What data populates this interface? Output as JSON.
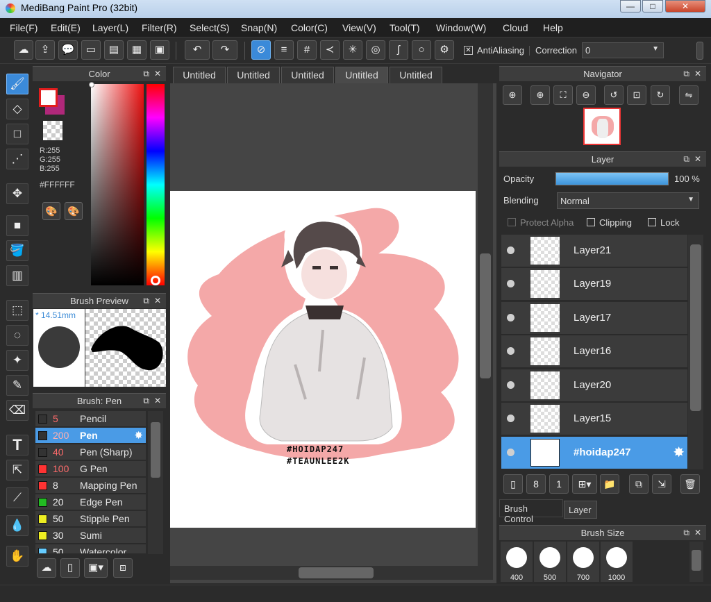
{
  "window": {
    "title": "MediBang Paint Pro (32bit)",
    "minimize": "—",
    "maximize": "□",
    "close": "✕"
  },
  "menu": [
    "File(F)",
    "Edit(E)",
    "Layer(L)",
    "Filter(R)",
    "Select(S)",
    "Snap(N)",
    "Color(C)",
    "View(V)",
    "Tool(T)",
    "Window(W)",
    "Cloud",
    "Help"
  ],
  "toolbar": {
    "antialiasing_label": "AntiAliasing",
    "correction_label": "Correction",
    "correction_value": "0"
  },
  "color_panel": {
    "title": "Color",
    "r": "R:255",
    "g": "G:255",
    "b": "B:255",
    "hex": "#FFFFFF",
    "primary": "#ffffff",
    "secondary": "#b0287a"
  },
  "brush_preview": {
    "title": "Brush Preview",
    "size": "* 14.51mm"
  },
  "brush_panel": {
    "title": "Brush: Pen",
    "items": [
      {
        "size": "5",
        "name": "Pencil",
        "color": "#333333"
      },
      {
        "size": "200",
        "name": "Pen",
        "color": "#333333",
        "selected": true
      },
      {
        "size": "40",
        "name": "Pen (Sharp)",
        "color": "#333333"
      },
      {
        "size": "100",
        "name": "G Pen",
        "color": "#ff3333"
      },
      {
        "size": "8",
        "name": "Mapping Pen",
        "color": "#ff3333"
      },
      {
        "size": "20",
        "name": "Edge Pen",
        "color": "#22bb22"
      },
      {
        "size": "50",
        "name": "Stipple Pen",
        "color": "#eeee22"
      },
      {
        "size": "30",
        "name": "Sumi",
        "color": "#eeee22"
      },
      {
        "size": "50",
        "name": "Watercolor",
        "color": "#66ccff"
      }
    ]
  },
  "tabs": [
    "Untitled",
    "Untitled",
    "Untitled",
    "Untitled",
    "Untitled"
  ],
  "canvas": {
    "tag1": "#HOIDAP247",
    "tag2": "#TEAUNLEE2K"
  },
  "navigator": {
    "title": "Navigator"
  },
  "layer_panel": {
    "title": "Layer",
    "opacity_label": "Opacity",
    "opacity_value": "100 %",
    "opacity_fraction": 1.0,
    "blending_label": "Blending",
    "blending_value": "Normal",
    "protect_alpha": "Protect Alpha",
    "clipping": "Clipping",
    "lock": "Lock",
    "layers": [
      "Layer21",
      "Layer19",
      "Layer17",
      "Layer16",
      "Layer20",
      "Layer15",
      "#hoidap247"
    ]
  },
  "bottom_tabs": {
    "brush_control": "Brush Control",
    "layer": "Layer"
  },
  "brush_size": {
    "title": "Brush Size",
    "sizes": [
      "400",
      "500",
      "700",
      "1000"
    ]
  }
}
